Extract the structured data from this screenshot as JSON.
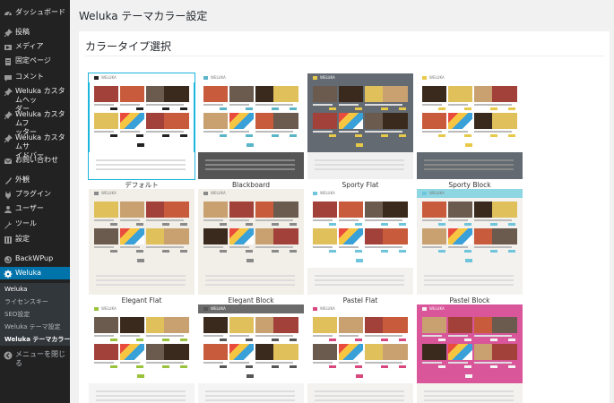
{
  "sidebar": {
    "items": [
      {
        "icon": "dashboard-icon",
        "label": "ダッシュボード"
      },
      {
        "icon": "pin-icon",
        "label": "投稿"
      },
      {
        "icon": "media-icon",
        "label": "メディア"
      },
      {
        "icon": "page-icon",
        "label": "固定ページ"
      },
      {
        "icon": "comment-icon",
        "label": "コメント"
      },
      {
        "icon": "pin-icon",
        "label": "Weluka カスタムヘッ\nダー"
      },
      {
        "icon": "pin-icon",
        "label": "Weluka カスタムフ\nッター"
      },
      {
        "icon": "pin-icon",
        "label": "Weluka カスタムサ\nイドバー"
      },
      {
        "icon": "mail-icon",
        "label": "お問い合わせ"
      },
      {
        "icon": "appearance-icon",
        "label": "外観"
      },
      {
        "icon": "plugin-icon",
        "label": "プラグイン"
      },
      {
        "icon": "user-icon",
        "label": "ユーザー"
      },
      {
        "icon": "tool-icon",
        "label": "ツール"
      },
      {
        "icon": "settings-icon",
        "label": "設定"
      },
      {
        "icon": "backup-icon",
        "label": "BackWPup"
      },
      {
        "icon": "gear-icon",
        "label": "Weluka"
      }
    ],
    "submenu": [
      "Weluka",
      "ライセンスキー",
      "SEO設定",
      "Weluka テーマ設定",
      "Weluka テーマカラー"
    ],
    "collapse_label": "メニューを閉じる"
  },
  "page": {
    "title": "Weluka テーマカラー設定",
    "section_title": "カラータイプ選択"
  },
  "themes": [
    {
      "name": "デフォルト",
      "bg": "#ffffff",
      "header": "#ffffff",
      "accent": "#222222",
      "footer": "#ffffff",
      "selected": true
    },
    {
      "name": "Blackboard",
      "bg": "#ffffff",
      "header": "#ffffff",
      "accent": "#5bb5c9",
      "footer": "#555555",
      "selected": false
    },
    {
      "name": "Sporty Flat",
      "bg": "#636a72",
      "header": "#636a72",
      "accent": "#e7c94a",
      "footer": "#f0f0f0",
      "selected": false
    },
    {
      "name": "Sporty Block",
      "bg": "#ffffff",
      "header": "#ffffff",
      "accent": "#e7c94a",
      "footer": "#636a72",
      "selected": false
    },
    {
      "name": "Elegant Flat",
      "bg": "#f2efe8",
      "header": "#f2efe8",
      "accent": "#8a8a8a",
      "footer": "#f2efe8",
      "selected": false
    },
    {
      "name": "Elegant Block",
      "bg": "#f2efe8",
      "header": "#f2efe8",
      "accent": "#8a8a8a",
      "footer": "#f2efe8",
      "selected": false
    },
    {
      "name": "Pastel Flat",
      "bg": "#ffffff",
      "header": "#ffffff",
      "accent": "#6fc5dc",
      "footer": "#f4f2ef",
      "selected": false
    },
    {
      "name": "Pastel Block",
      "bg": "#f4f2ef",
      "header": "#8fd6e3",
      "accent": "#6fc5dc",
      "footer": "#f4f2ef",
      "selected": false
    },
    {
      "name": "",
      "bg": "#ffffff",
      "header": "#ffffff",
      "accent": "#9ac23c",
      "footer": "#f4f4f4",
      "selected": false
    },
    {
      "name": "",
      "bg": "#ffffff",
      "header": "#6b6b6b",
      "accent": "#555555",
      "footer": "#f4f4f4",
      "selected": false
    },
    {
      "name": "",
      "bg": "#ffffff",
      "header": "#ffffff",
      "accent": "#d9477f",
      "footer": "#f4f2ef",
      "selected": false
    },
    {
      "name": "",
      "bg": "#d9569a",
      "header": "#d9569a",
      "accent": "#f4f4f4",
      "footer": "#f4f2ef",
      "selected": false
    }
  ],
  "brand_label": "WELUKA"
}
